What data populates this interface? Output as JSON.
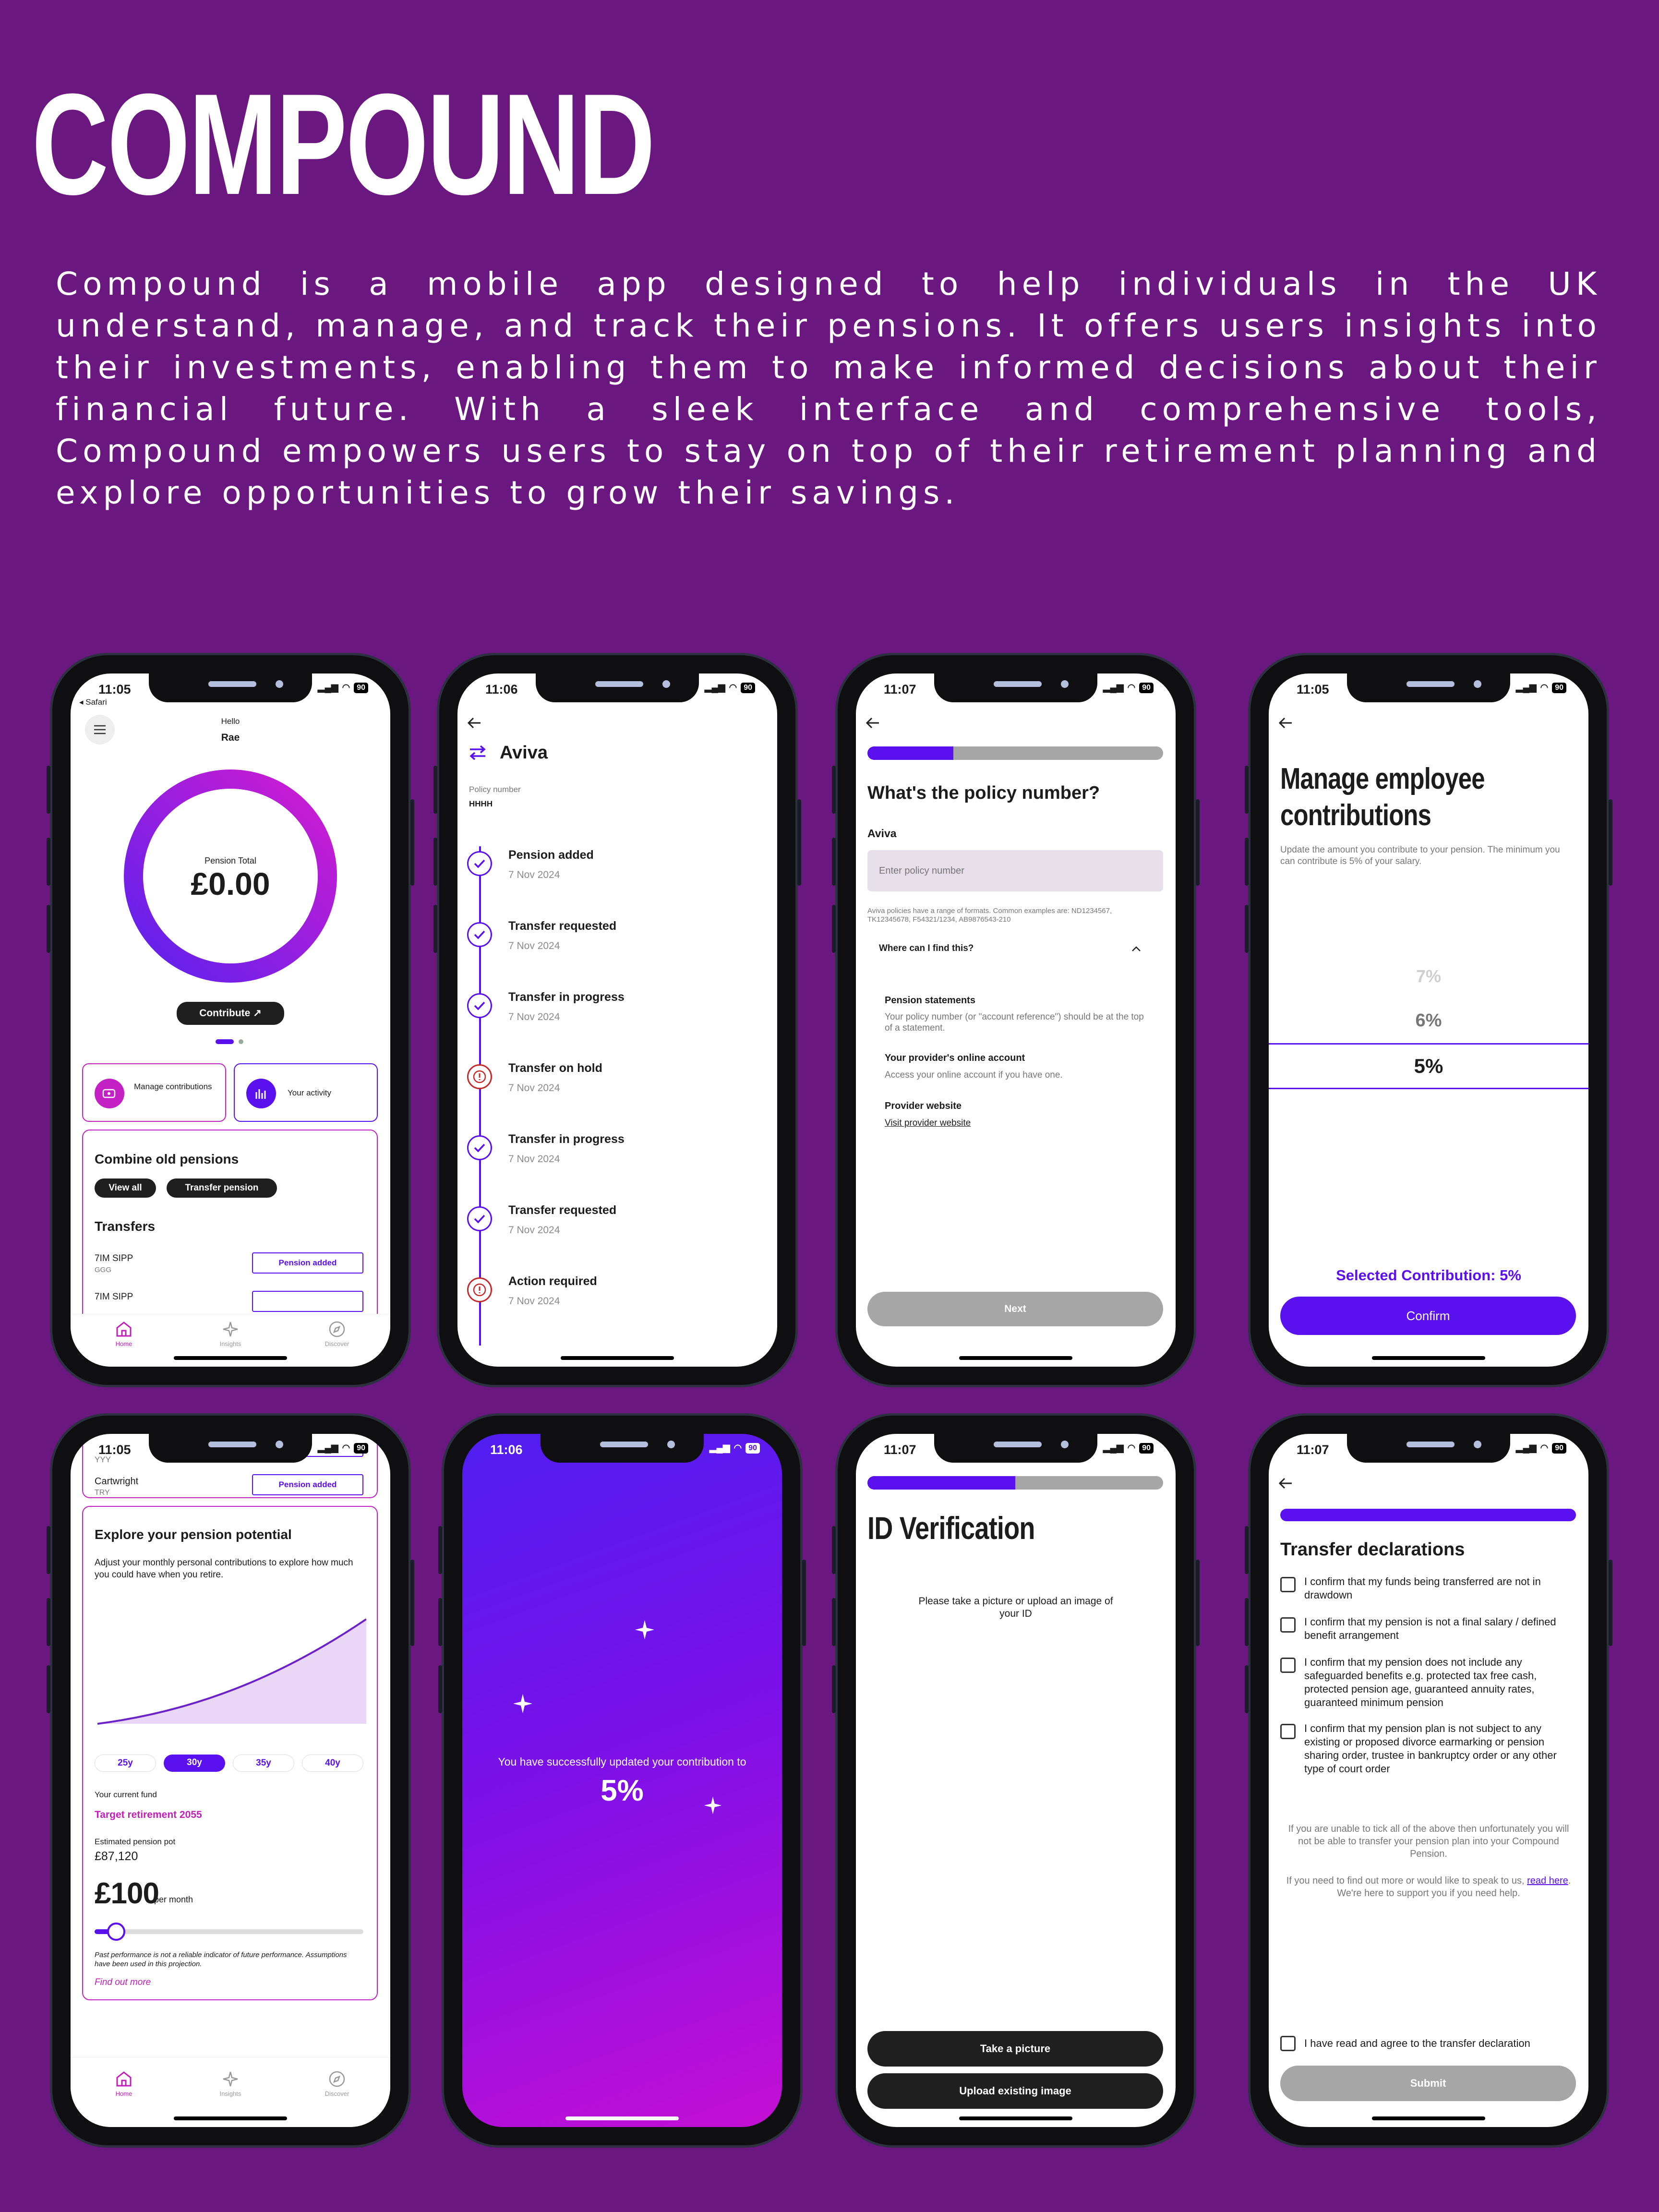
{
  "brand": {
    "title": "COMPOUND"
  },
  "intro": "Compound is a mobile app designed to help individuals in the UK understand, manage, and track their pensions. It offers users insights into their investments, enabling them to make informed decisions about their financial future. With a sleek interface and comprehensive tools, Compound empowers users to stay on top of their retirement planning and explore opportunities to grow their savings.",
  "colors": {
    "background": "#6b1780",
    "accent": "#5b10f0",
    "magenta": "#c21fb9",
    "danger": "#c42a2a"
  },
  "status": {
    "battery": "90"
  },
  "screen1": {
    "time": "11:05",
    "back_app": "◂ Safari",
    "greeting": "Hello",
    "user": "Rae",
    "ring_label": "Pension Total",
    "ring_value": "£0.00",
    "contribute": "Contribute",
    "manage": "Manage contributions",
    "activity": "Your activity",
    "combine_title": "Combine old pensions",
    "view_all": "View all",
    "transfer_pension": "Transfer pension",
    "transfers_title": "Transfers",
    "transfers": [
      {
        "name": "7IM SIPP",
        "sub": "GGG",
        "status": "Pension added"
      },
      {
        "name": "7IM SIPP",
        "sub": "",
        "status": ""
      }
    ],
    "tabs": [
      "Home",
      "Insights",
      "Discover"
    ]
  },
  "screen2": {
    "time": "11:06",
    "title": "Aviva",
    "policy_label": "Policy number",
    "policy_value": "HHHH",
    "timeline": [
      {
        "title": "Pension added",
        "date": "7 Nov 2024",
        "status": "done"
      },
      {
        "title": "Transfer requested",
        "date": "7 Nov 2024",
        "status": "done"
      },
      {
        "title": "Transfer in progress",
        "date": "7 Nov 2024",
        "status": "done"
      },
      {
        "title": "Transfer on hold",
        "date": "7 Nov 2024",
        "status": "warn"
      },
      {
        "title": "Transfer in progress",
        "date": "7 Nov 2024",
        "status": "done"
      },
      {
        "title": "Transfer requested",
        "date": "7 Nov 2024",
        "status": "done"
      },
      {
        "title": "Action required",
        "date": "7 Nov 2024",
        "status": "warn"
      }
    ]
  },
  "screen3": {
    "time": "11:07",
    "progress": 0.29,
    "title": "What's the policy number?",
    "provider": "Aviva",
    "placeholder": "Enter policy number",
    "hint": "Aviva policies have a range of formats. Common examples are: ND1234567, TK12345678, F54321/1234, AB9876543-210",
    "faq_title": "Where can I find this?",
    "faq": [
      {
        "title": "Pension statements",
        "body": "Your policy number (or \"account reference\") should be at the top of a statement."
      },
      {
        "title": "Your provider's online account",
        "body": "Access your online account if you have one."
      },
      {
        "title": "Provider website",
        "body": "Visit provider website"
      }
    ],
    "next": "Next"
  },
  "screen4": {
    "time": "11:05",
    "title": "Manage employee contributions",
    "desc": "Update the amount you contribute to your pension. The minimum you can contribute is 5% of your salary.",
    "options": [
      "7%",
      "6%",
      "5%"
    ],
    "selected_label": "Selected Contribution: 5%",
    "confirm": "Confirm"
  },
  "screen5": {
    "time": "11:05",
    "rows": [
      {
        "name": "YYY",
        "sub": "",
        "status": ""
      },
      {
        "name": "Cartwright",
        "sub": "TRY",
        "status": "Pension added"
      }
    ],
    "explore_title": "Explore your pension potential",
    "explore_desc": "Adjust your monthly personal contributions to explore how much you could have when you retire.",
    "years": [
      "25y",
      "30y",
      "35y",
      "40y"
    ],
    "selected_year": "30y",
    "fund_label": "Your current fund",
    "fund_value": "Target retirement 2055",
    "pot_label": "Estimated pension pot",
    "pot_value": "£87,120",
    "monthly_value": "£100",
    "monthly_unit": "per month",
    "slider_level": 0.08,
    "disclaimer": "Past performance is not a reliable indicator of future performance. Assumptions have been used in this projection.",
    "find_out": "Find out more",
    "tabs": [
      "Home",
      "Insights",
      "Discover"
    ]
  },
  "screen6": {
    "time": "11:06",
    "message": "You have successfully updated your contribution to",
    "value": "5%"
  },
  "screen7": {
    "time": "11:07",
    "progress": 0.5,
    "title": "ID Verification",
    "desc": "Please take a picture or upload an image of your ID",
    "take": "Take a picture",
    "upload": "Upload existing image"
  },
  "screen8": {
    "time": "11:07",
    "progress": 1,
    "title": "Transfer declarations",
    "declarations": [
      "I confirm that my funds being transferred are not in drawdown",
      "I confirm that my pension is not a final salary / defined benefit arrangement",
      "I confirm that my pension does not include any safeguarded benefits e.g. protected tax free cash, protected pension age, guaranteed annuity rates, guaranteed minimum pension",
      "I confirm that my pension plan is not subject to any existing or proposed divorce earmarking or pension sharing order, trustee in bankruptcy order or any other type of court order"
    ],
    "warning": "If you are unable to tick all of the above then unfortunately you will not be able to transfer your pension plan into your Compound Pension.",
    "help_pre": "If you need to find out more or would like to speak to us,",
    "help_link": "read here",
    "help_post": ". We're here to support you if you need help.",
    "agree": "I have read and agree to the transfer declaration",
    "submit": "Submit"
  }
}
